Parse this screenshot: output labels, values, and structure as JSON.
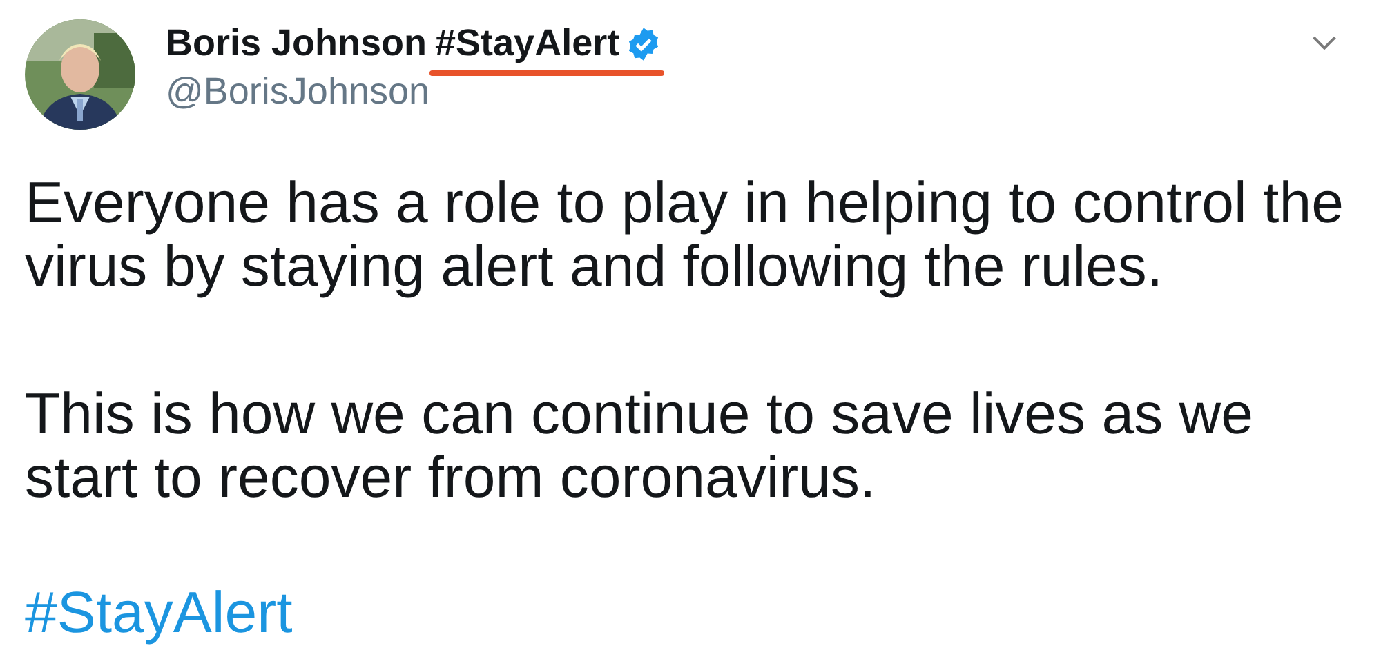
{
  "tweet": {
    "author": {
      "name": "Boris Johnson",
      "name_hashtag": "#StayAlert",
      "verified": true,
      "handle": "@BorisJohnson"
    },
    "annotation": {
      "kind": "underline",
      "color": "#e8532a"
    },
    "paragraphs": [
      "Everyone has a role to play in helping to control the virus by staying alert and following the rules.",
      "This is how we can continue to save lives as we start to recover from coronavirus."
    ],
    "hashtag": "#StayAlert"
  }
}
